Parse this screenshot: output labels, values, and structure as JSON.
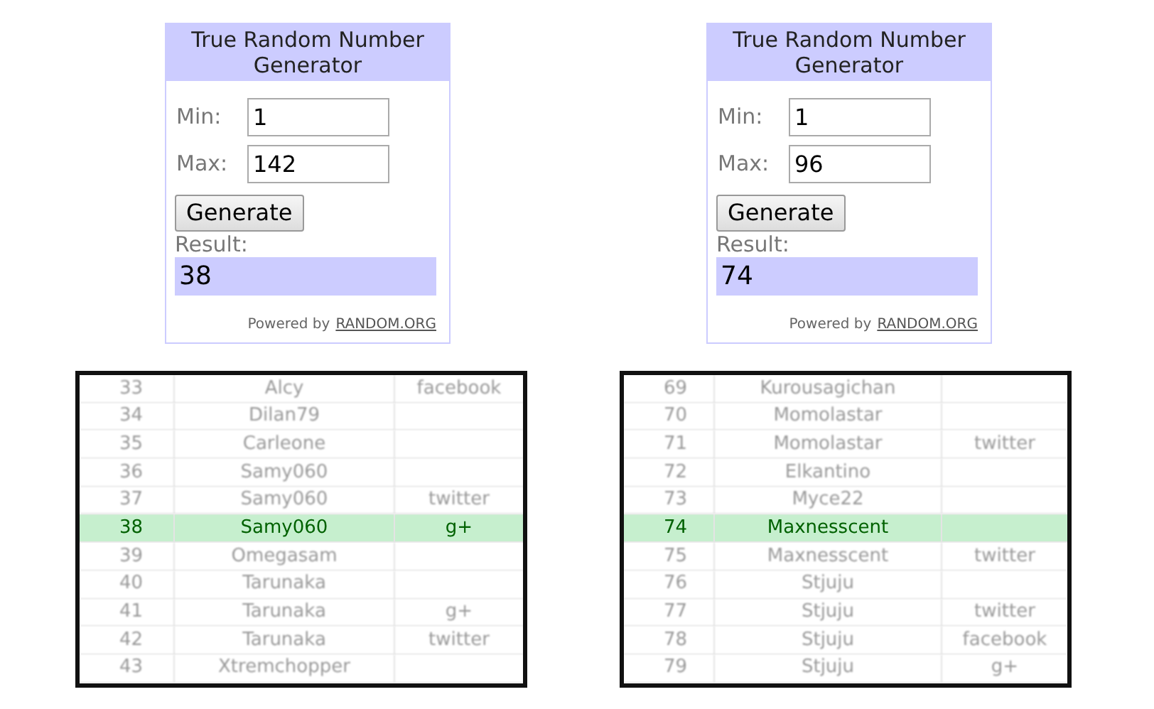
{
  "widgets": [
    {
      "title": "True Random Number Generator",
      "min_label": "Min:",
      "min_value": "1",
      "max_label": "Max:",
      "max_value": "142",
      "button": "Generate",
      "result_label": "Result:",
      "result": "38",
      "powered_by": "Powered by",
      "link": "RANDOM.ORG"
    },
    {
      "title": "True Random Number Generator",
      "min_label": "Min:",
      "min_value": "1",
      "max_label": "Max:",
      "max_value": "96",
      "button": "Generate",
      "result_label": "Result:",
      "result": "74",
      "powered_by": "Powered by",
      "link": "RANDOM.ORG"
    }
  ],
  "tables": [
    {
      "rows": [
        {
          "number": "33",
          "name": "Alcy",
          "source": "facebook",
          "selected": false
        },
        {
          "number": "34",
          "name": "Dilan79",
          "source": "",
          "selected": false
        },
        {
          "number": "35",
          "name": "Carleone",
          "source": "",
          "selected": false
        },
        {
          "number": "36",
          "name": "Samy060",
          "source": "",
          "selected": false
        },
        {
          "number": "37",
          "name": "Samy060",
          "source": "twitter",
          "selected": false
        },
        {
          "number": "38",
          "name": "Samy060",
          "source": "g+",
          "selected": true
        },
        {
          "number": "39",
          "name": "Omegasam",
          "source": "",
          "selected": false
        },
        {
          "number": "40",
          "name": "Tarunaka",
          "source": "",
          "selected": false
        },
        {
          "number": "41",
          "name": "Tarunaka",
          "source": "g+",
          "selected": false
        },
        {
          "number": "42",
          "name": "Tarunaka",
          "source": "twitter",
          "selected": false
        },
        {
          "number": "43",
          "name": "Xtremchopper",
          "source": "",
          "selected": false
        }
      ]
    },
    {
      "rows": [
        {
          "number": "69",
          "name": "Kurousagichan",
          "source": "",
          "selected": false
        },
        {
          "number": "70",
          "name": "Momolastar",
          "source": "",
          "selected": false
        },
        {
          "number": "71",
          "name": "Momolastar",
          "source": "twitter",
          "selected": false
        },
        {
          "number": "72",
          "name": "Elkantino",
          "source": "",
          "selected": false
        },
        {
          "number": "73",
          "name": "Myce22",
          "source": "",
          "selected": false
        },
        {
          "number": "74",
          "name": "Maxnesscent",
          "source": "",
          "selected": true
        },
        {
          "number": "75",
          "name": "Maxnesscent",
          "source": "twitter",
          "selected": false
        },
        {
          "number": "76",
          "name": "Stjuju",
          "source": "",
          "selected": false
        },
        {
          "number": "77",
          "name": "Stjuju",
          "source": "twitter",
          "selected": false
        },
        {
          "number": "78",
          "name": "Stjuju",
          "source": "facebook",
          "selected": false
        },
        {
          "number": "79",
          "name": "Stjuju",
          "source": "g+",
          "selected": false
        }
      ]
    }
  ]
}
